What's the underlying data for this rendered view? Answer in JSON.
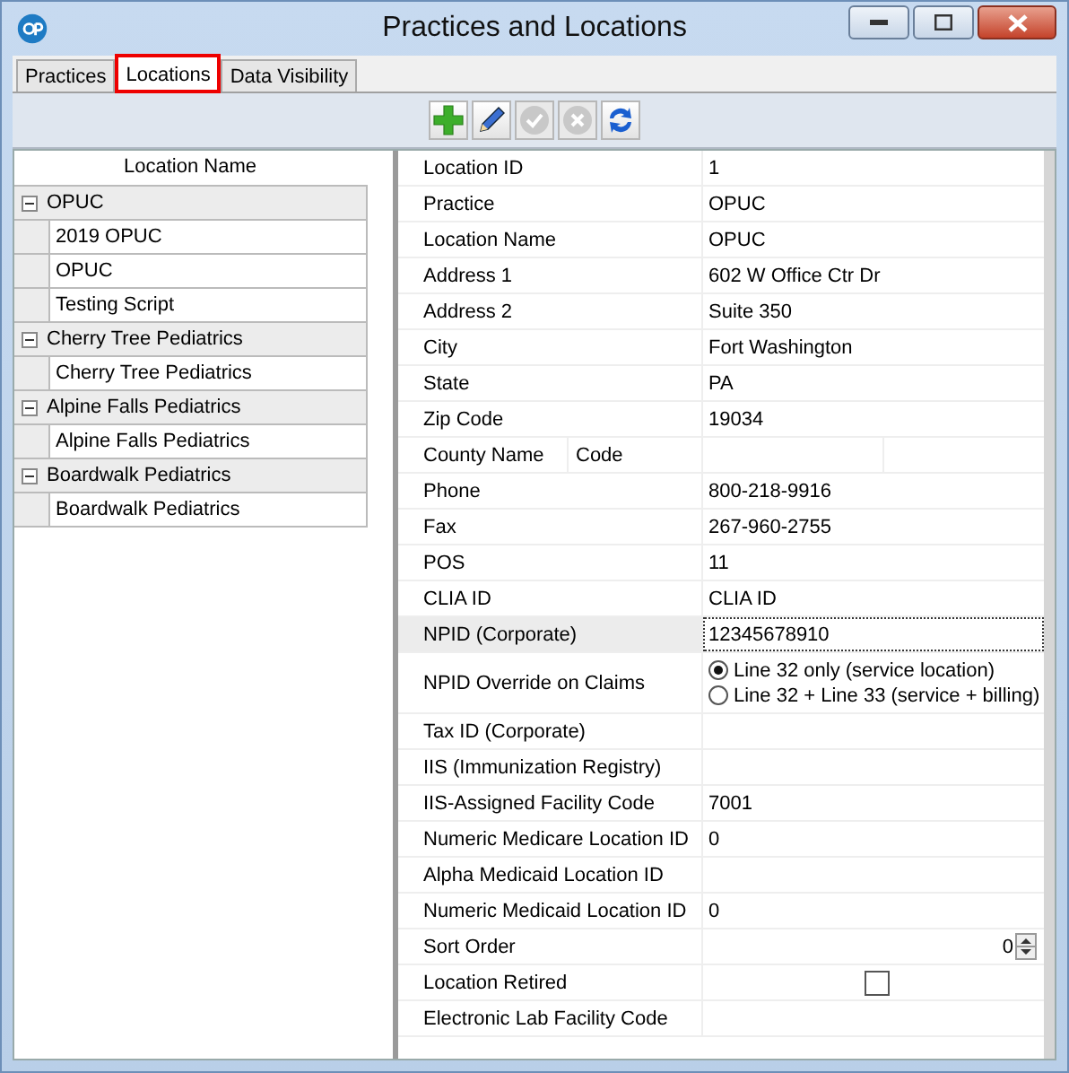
{
  "window": {
    "title": "Practices and Locations"
  },
  "tabs": [
    {
      "label": "Practices",
      "selected": false
    },
    {
      "label": "Locations",
      "selected": true,
      "outlined": true
    },
    {
      "label": "Data Visibility",
      "selected": false
    }
  ],
  "toolbar": [
    {
      "kind": "add",
      "disabled": false
    },
    {
      "kind": "edit",
      "disabled": false
    },
    {
      "kind": "confirm",
      "disabled": true
    },
    {
      "kind": "cancel",
      "disabled": true
    },
    {
      "kind": "refresh",
      "disabled": false
    }
  ],
  "tree": {
    "header": "Location Name",
    "groups": [
      {
        "label": "OPUC",
        "expanded": true,
        "children": [
          {
            "label": "2019 OPUC"
          },
          {
            "label": "OPUC"
          },
          {
            "label": "Testing Script"
          }
        ]
      },
      {
        "label": "Cherry Tree Pediatrics",
        "expanded": true,
        "children": [
          {
            "label": "Cherry Tree Pediatrics"
          }
        ]
      },
      {
        "label": "Alpine Falls Pediatrics",
        "expanded": true,
        "children": [
          {
            "label": "Alpine Falls Pediatrics"
          }
        ]
      },
      {
        "label": "Boardwalk Pediatrics",
        "expanded": true,
        "children": [
          {
            "label": "Boardwalk Pediatrics"
          }
        ]
      }
    ]
  },
  "fields": [
    {
      "kind": "text",
      "label": "Location ID",
      "value": "1",
      "selected": false
    },
    {
      "kind": "text",
      "label": "Practice",
      "value": "OPUC",
      "selected": false
    },
    {
      "kind": "text",
      "label": "Location Name",
      "value": "OPUC",
      "selected": false
    },
    {
      "kind": "text",
      "label": "Address 1",
      "value": "602 W Office Ctr Dr",
      "selected": false
    },
    {
      "kind": "text",
      "label": "Address 2",
      "value": "Suite 350",
      "selected": false
    },
    {
      "kind": "text",
      "label": "City",
      "value": "Fort Washington",
      "selected": false
    },
    {
      "kind": "text",
      "label": "State",
      "value": "PA",
      "selected": false
    },
    {
      "kind": "text",
      "label": "Zip Code",
      "value": "19034",
      "selected": false
    },
    {
      "kind": "split",
      "label": "County Name",
      "label_2": "Code",
      "selected": false
    },
    {
      "kind": "text",
      "label": "Phone",
      "value": "800-218-9916",
      "selected": false
    },
    {
      "kind": "text",
      "label": "Fax",
      "value": "267-960-2755",
      "selected": false
    },
    {
      "kind": "text",
      "label": "POS",
      "value": "11",
      "selected": false
    },
    {
      "kind": "text",
      "label": "CLIA ID",
      "value": "CLIA ID",
      "selected": false
    },
    {
      "kind": "text",
      "label": "NPID (Corporate)",
      "value": "12345678910",
      "selected": true
    },
    {
      "kind": "radio",
      "label": "NPID Override on Claims",
      "selected": false,
      "options": [
        {
          "label": "Line 32 only (service location)",
          "selected": true
        },
        {
          "label": "Line 32 + Line 33 (service + billing)",
          "selected": false
        }
      ]
    },
    {
      "kind": "text",
      "label": "Tax ID (Corporate)",
      "selected": false
    },
    {
      "kind": "text",
      "label": "IIS (Immunization Registry)",
      "selected": false
    },
    {
      "kind": "text",
      "label": "IIS-Assigned Facility Code",
      "value": "7001",
      "selected": false
    },
    {
      "kind": "text",
      "label": "Numeric Medicare Location ID",
      "value": "0",
      "selected": false
    },
    {
      "kind": "text",
      "label": "Alpha Medicaid Location ID",
      "selected": false
    },
    {
      "kind": "text",
      "label": "Numeric Medicaid Location ID",
      "value": "0",
      "selected": false
    },
    {
      "kind": "spinner",
      "label": "Sort Order",
      "value": "0",
      "selected": false
    },
    {
      "kind": "checkbox",
      "label": "Location Retired",
      "checked": false,
      "selected": false
    },
    {
      "kind": "text",
      "label": "Electronic Lab Facility Code",
      "selected": false
    }
  ]
}
